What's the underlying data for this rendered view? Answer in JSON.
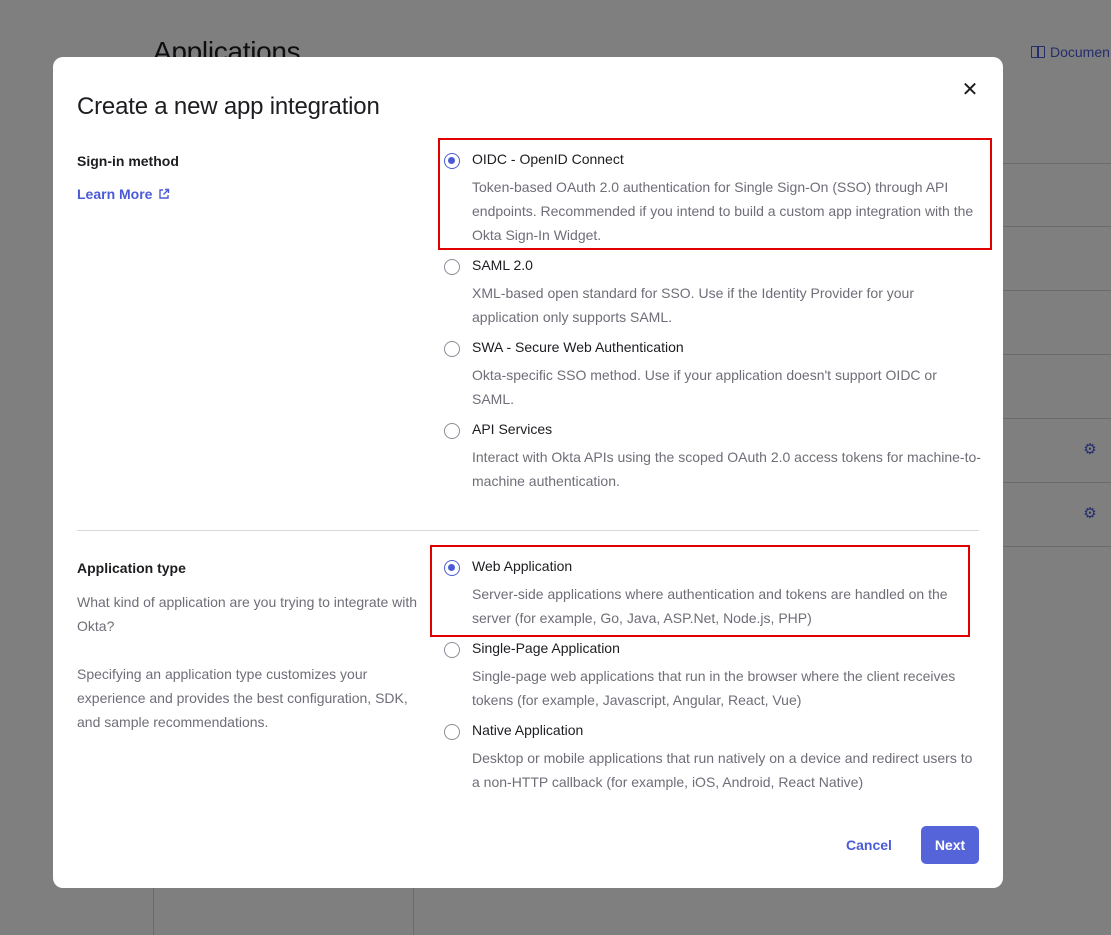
{
  "background": {
    "page_title": "Applications",
    "documentation_link": "Documen"
  },
  "modal": {
    "title": "Create a new app integration",
    "close_label": "✕",
    "sign_in": {
      "label": "Sign-in method",
      "learn_more": "Learn More",
      "options": [
        {
          "title": "OIDC - OpenID Connect",
          "desc": "Token-based OAuth 2.0 authentication for Single Sign-On (SSO) through API endpoints. Recommended if you intend to build a custom app integration with the Okta Sign-In Widget.",
          "checked": true
        },
        {
          "title": "SAML 2.0",
          "desc": "XML-based open standard for SSO. Use if the Identity Provider for your application only supports SAML.",
          "checked": false
        },
        {
          "title": "SWA - Secure Web Authentication",
          "desc": "Okta-specific SSO method. Use if your application doesn't support OIDC or SAML.",
          "checked": false
        },
        {
          "title": "API Services",
          "desc": "Interact with Okta APIs using the scoped OAuth 2.0 access tokens for machine-to-machine authentication.",
          "checked": false
        }
      ]
    },
    "app_type": {
      "label": "Application type",
      "desc1": "What kind of application are you trying to integrate with Okta?",
      "desc2": "Specifying an application type customizes your experience and provides the best configuration, SDK, and sample recommendations.",
      "options": [
        {
          "title": "Web Application",
          "desc": "Server-side applications where authentication and tokens are handled on the server (for example, Go, Java, ASP.Net, Node.js, PHP)",
          "checked": true
        },
        {
          "title": "Single-Page Application",
          "desc": "Single-page web applications that run in the browser where the client receives tokens (for example, Javascript, Angular, React, Vue)",
          "checked": false
        },
        {
          "title": "Native Application",
          "desc": "Desktop or mobile applications that run natively on a device and redirect users to a non-HTTP callback (for example, iOS, Android, React Native)",
          "checked": false
        }
      ]
    },
    "buttons": {
      "cancel": "Cancel",
      "next": "Next"
    }
  },
  "colors": {
    "accent": "#4b5bd6",
    "highlight": "#e10000"
  }
}
